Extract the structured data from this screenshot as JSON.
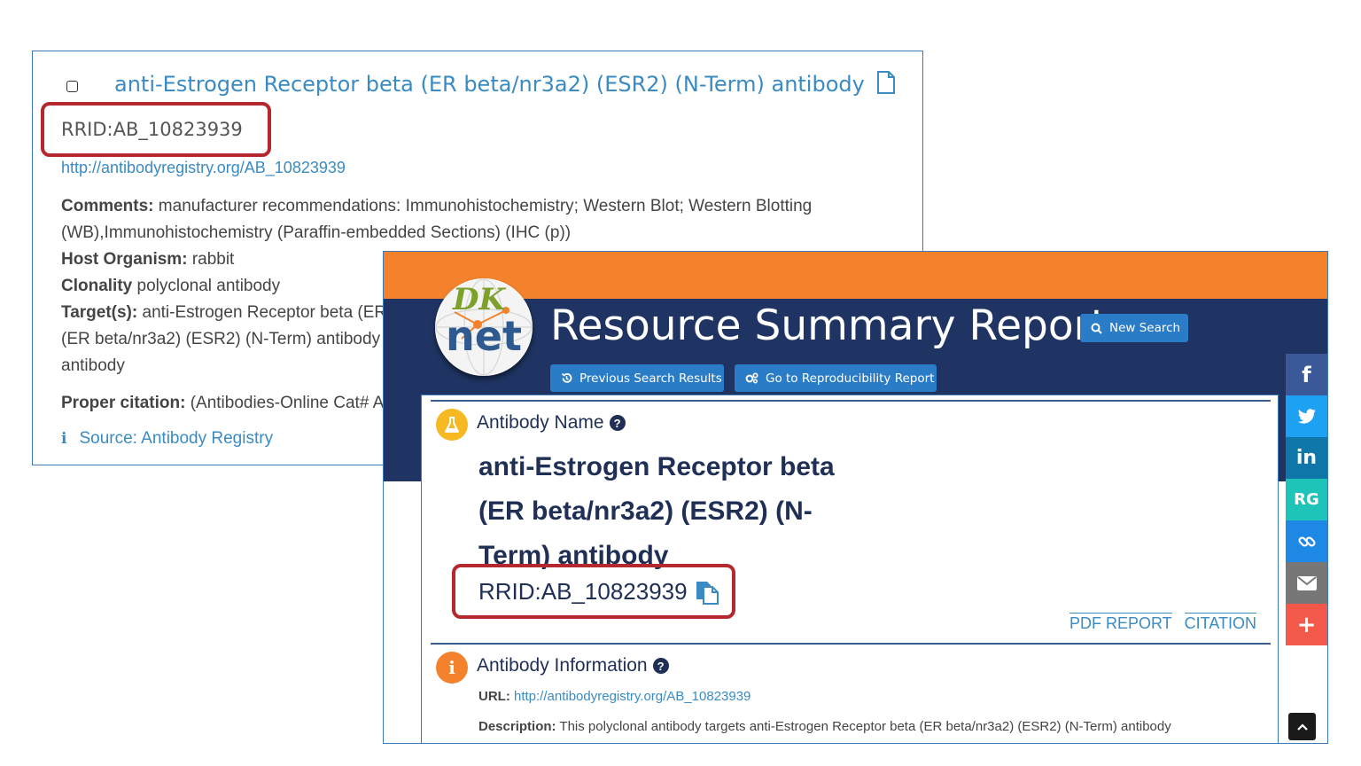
{
  "registry_card": {
    "title": "anti-Estrogen Receptor beta (ER beta/nr3a2) (ESR2) (N-Term) antibody",
    "rrid": "RRID:AB_10823939",
    "url": "http://antibodyregistry.org/AB_10823939",
    "comments_label": "Comments:",
    "comments_line1": "manufacturer recommendations: Immunohistochemistry; Western Blot; Western Blotting",
    "comments_line2": "(WB),Immunohistochemistry (Paraffin-embedded Sections) (IHC (p))",
    "host_label": "Host Organism:",
    "host_value": "rabbit",
    "clonality_label": "Clonality",
    "clonality_value": "polyclonal antibody",
    "targets_label": "Target(s):",
    "targets_line1": "anti-Estrogen Receptor beta (ER",
    "targets_line2": "(ER beta/nr3a2) (ESR2) (N-Term) antibody",
    "targets_line3": "antibody",
    "citation_label": "Proper citation:",
    "citation_value": "(Antibodies-Online Cat# A",
    "source_label": "Source: Antibody Registry"
  },
  "report": {
    "logo_text_top": "DK",
    "logo_text_bottom": "net",
    "title": "Resource Summary Report",
    "new_search_label": "New Search",
    "prev_results_label": "Previous Search Results",
    "repro_label": "Go to Reproducibility Report",
    "antibody_name_heading": "Antibody Name",
    "antibody_name_line1": "anti-Estrogen Receptor beta",
    "antibody_name_line2": "(ER beta/nr3a2) (ESR2) (N-",
    "antibody_name_line3": "Term) antibody",
    "rrid": "RRID:AB_10823939",
    "pdf_report_label": "PDF REPORT",
    "citation_label": "CITATION",
    "antibody_info_heading": "Antibody Information",
    "url_label": "URL:",
    "url_value": "http://antibodyregistry.org/AB_10823939",
    "description_label": "Description:",
    "description_value": "This polyclonal antibody targets anti-Estrogen Receptor beta (ER beta/nr3a2) (ESR2) (N-Term) antibody"
  },
  "share": {
    "researchgate_label": "RG"
  },
  "colors": {
    "link_blue": "#3a8bc4",
    "navy": "#1f3462",
    "orange": "#f4822d",
    "highlight_red": "#b4282e",
    "button_blue": "#2a7cc7",
    "facebook": "#3b5998",
    "twitter": "#1da1f2",
    "linkedin": "#0e76a8",
    "researchgate": "#1fc4b8",
    "link_share": "#1e88e5",
    "email": "#777777",
    "more": "#f4584a"
  }
}
